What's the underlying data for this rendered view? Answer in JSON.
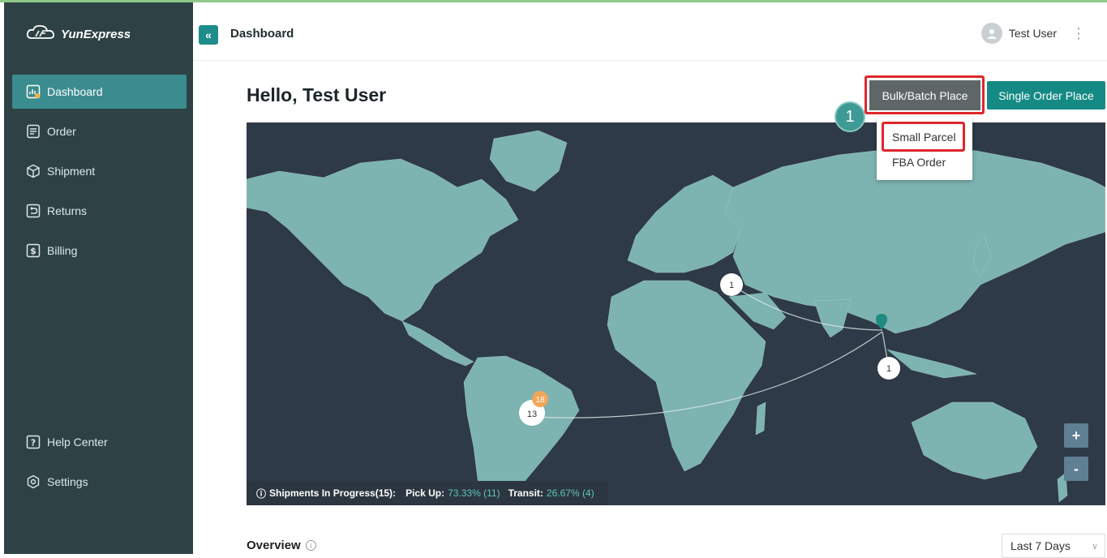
{
  "brand": {
    "name": "YunExpress"
  },
  "sidebar": {
    "items": [
      {
        "label": "Dashboard",
        "icon": "dashboard-icon"
      },
      {
        "label": "Order",
        "icon": "order-icon"
      },
      {
        "label": "Shipment",
        "icon": "box-icon"
      },
      {
        "label": "Returns",
        "icon": "returns-icon"
      },
      {
        "label": "Billing",
        "icon": "dollar-icon"
      }
    ],
    "bottom": [
      {
        "label": "Help Center",
        "icon": "help-icon"
      },
      {
        "label": "Settings",
        "icon": "settings-icon"
      }
    ]
  },
  "header": {
    "collapse_icon": "«",
    "breadcrumb": "Dashboard",
    "user_name": "Test User"
  },
  "main": {
    "greeting": "Hello, Test User",
    "bulk_button": "Bulk/Batch Place",
    "single_button": "Single Order Place",
    "dropdown": [
      "Small Parcel",
      "FBA Order"
    ],
    "step_badge": "1"
  },
  "map": {
    "markers": [
      {
        "label": "1",
        "place": "middle-east"
      },
      {
        "label": "1",
        "place": "southeast-asia"
      },
      {
        "label": "13",
        "place": "brazil"
      },
      {
        "label": "18",
        "place": "brazil-badge"
      }
    ],
    "zoom_in": "+",
    "zoom_out": "-",
    "stats": {
      "title": "Shipments In Progress(15):",
      "pickup_label": "Pick Up:",
      "pickup_value": "73.33% (11)",
      "transit_label": "Transit:",
      "transit_value": "26.67% (4)"
    },
    "colors": {
      "ocean": "#2e3a47",
      "land": "#7db3b0"
    }
  },
  "overview": {
    "title": "Overview",
    "period": "Last 7 Days"
  }
}
